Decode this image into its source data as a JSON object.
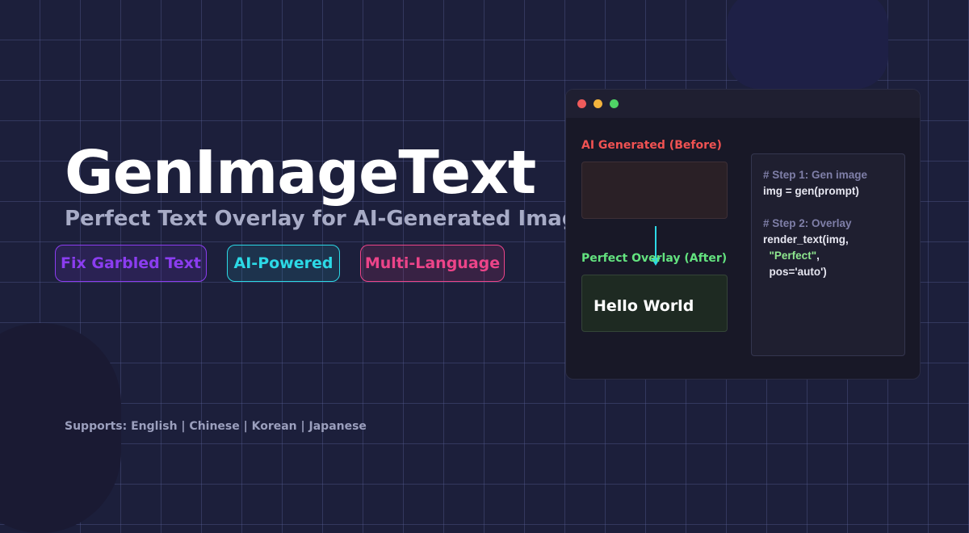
{
  "hero": {
    "title": "GenImageText",
    "subtitle": "Perfect Text Overlay for AI-Generated Image"
  },
  "badges": [
    {
      "label": "Fix Garbled Text",
      "color": "#8b3df0"
    },
    {
      "label": "AI-Powered",
      "color": "#2cd9e6"
    },
    {
      "label": "Multi-Language",
      "color": "#ec4489"
    }
  ],
  "supports": "Supports: English | Chinese | Korean | Japanese",
  "demo_window": {
    "before_label": "AI Generated (Before)",
    "after_label": "Perfect Overlay (After)",
    "after_text": "Hello World",
    "code": {
      "comment1": "# Step 1: Gen image",
      "line2": "img = gen(prompt)",
      "comment2": "# Step 2: Overlay",
      "line4": "render_text(img,",
      "string_arg": "\"Perfect\"",
      "string_suffix": ",",
      "line6": "  pos='auto')"
    }
  },
  "colors": {
    "background": "#1c1f3b",
    "before_label": "#f05252",
    "after_label": "#63e27f",
    "arrow": "#2cd9e6",
    "window_dots": [
      "#ef5b5b",
      "#f2b33d",
      "#4fd466"
    ]
  }
}
